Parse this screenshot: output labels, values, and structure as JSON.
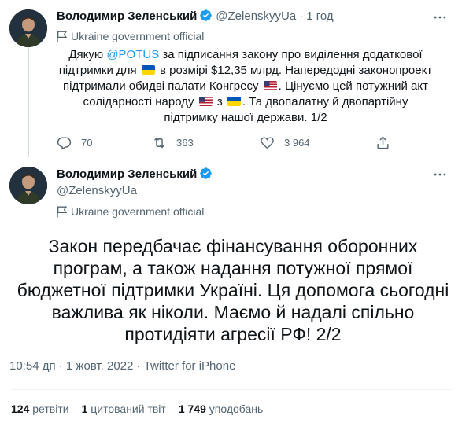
{
  "tweet1": {
    "author_name": "Володимир Зеленський",
    "handle": "@ZelenskyyUa",
    "separator": "·",
    "time": "1 год",
    "label": "Ukraine government official",
    "text": {
      "p1": "Дякую ",
      "mention": "@POTUS",
      "p2": " за підписання закону про виділення додаткової підтримки для ",
      "p3": " в розмірі $12,35 млрд. Напередодні законопроект підтримали обидві палати Конгресу ",
      "p4": ". Цінуємо цей потужний акт солідарності народу ",
      "p5": " з ",
      "p6": ". Та двопалатну й двопартійну підтримку нашої держави. 1/2"
    },
    "replies": "70",
    "retweets": "363",
    "likes": "3 964"
  },
  "tweet2": {
    "author_name": "Володимир Зеленський",
    "handle": "@ZelenskyyUa",
    "label": "Ukraine government official",
    "text": "Закон передбачає фінансування оборонних програм, а також надання потужної прямої бюджетної підтримки Україні. Ця допомога сьогодні важлива як ніколи. Маємо й надалі спільно протидіяти агресії РФ! 2/2",
    "timestamp": "10:54 дп · 1 жовт. 2022",
    "meta_sep": " · ",
    "source": "Twitter for iPhone",
    "stats": {
      "retweets_count": "124",
      "retweets_label": "ретвіти",
      "quotes_count": "1",
      "quotes_label": "цитований твіт",
      "likes_count": "1 749",
      "likes_label": "уподобань"
    }
  },
  "colors": {
    "accent": "#1d9bf0",
    "secondary_text": "#536471",
    "primary_text": "#0f1419",
    "divider": "#eff3f4"
  },
  "icons": {
    "verified": "verified-badge-icon",
    "government": "government-flag-icon",
    "more": "more-dots-icon",
    "reply": "reply-icon",
    "retweet": "retweet-icon",
    "like": "heart-icon",
    "share": "share-icon",
    "flags": [
      "ukraine-flag-icon",
      "us-flag-icon"
    ]
  }
}
